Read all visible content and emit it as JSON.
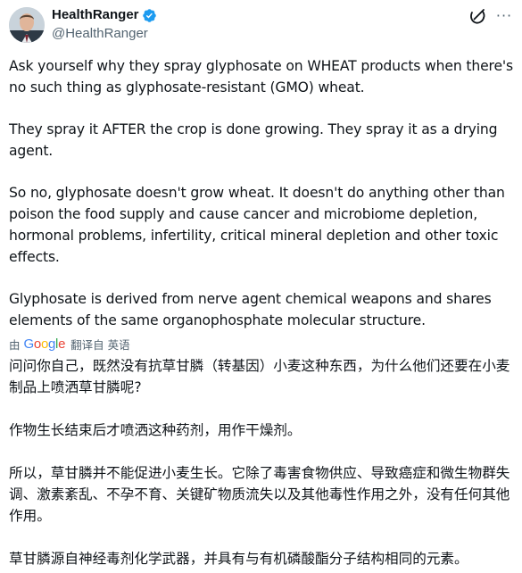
{
  "tweet": {
    "author": {
      "display_name": "HealthRanger",
      "handle": "@HealthRanger",
      "verified_icon": "verified-badge-icon",
      "avatar_icon": "avatar"
    },
    "actions": {
      "grok_icon": "grok-icon",
      "more_icon": "more-options-icon",
      "more_glyph": "···"
    },
    "paragraphs": [
      "Ask yourself why they spray glyphosate on WHEAT products when there's no such thing as glyphosate-resistant (GMO) wheat.",
      "They spray it AFTER the crop is done growing. They spray it as a drying agent.",
      "So no, glyphosate doesn't grow wheat. It doesn't do anything other than poison the food supply and cause cancer and microbiome depletion, hormonal problems, infertility, critical mineral depletion and other toxic effects.",
      "Glyphosate is derived from nerve agent chemical weapons and shares elements of the same organophosphate molecular structure."
    ],
    "translation": {
      "by_label": "由",
      "provider": "Google",
      "from_label": "翻译自 英语",
      "paragraphs": [
        "问问你自己，既然没有抗草甘膦（转基因）小麦这种东西，为什么他们还要在小麦制品上喷洒草甘膦呢?",
        "作物生长结束后才喷洒这种药剂，用作干燥剂。",
        "所以，草甘膦并不能促进小麦生长。它除了毒害食物供应、导致癌症和微生物群失调、激素紊乱、不孕不育、关键矿物质流失以及其他毒性作用之外，没有任何其他作用。",
        "草甘膦源自神经毒剂化学武器，并具有与有机磷酸酯分子结构相同的元素。"
      ]
    },
    "colors": {
      "text": "#0f1419",
      "secondary": "#536471",
      "verified": "#1d9bf0"
    }
  }
}
